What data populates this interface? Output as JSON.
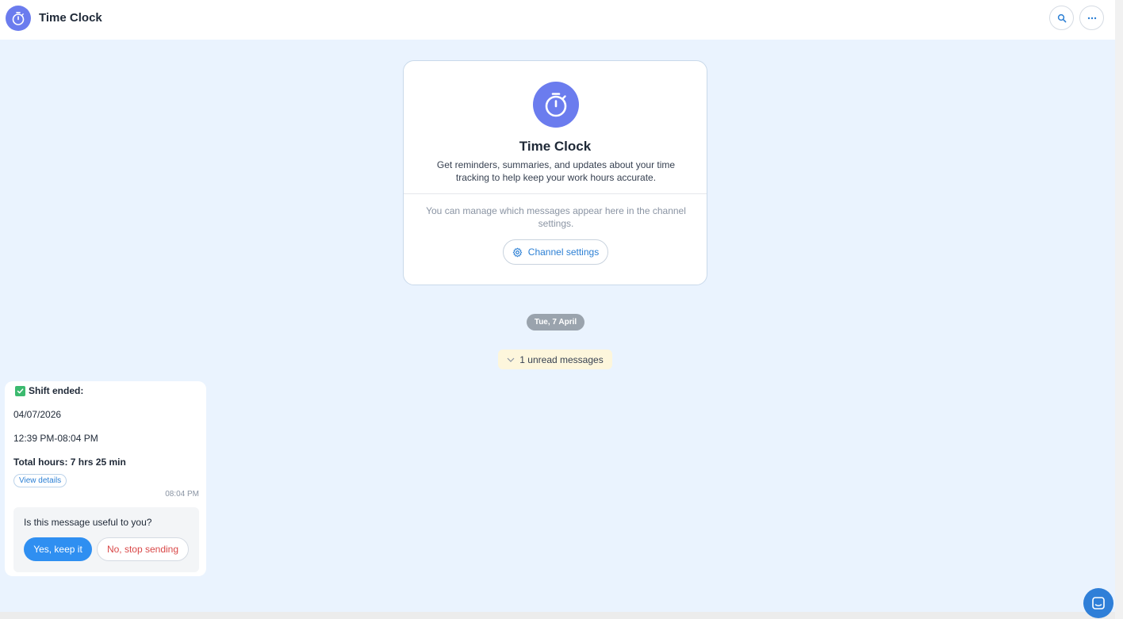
{
  "header": {
    "title": "Time Clock",
    "logo_icon": "stopwatch-icon",
    "search_icon": "search-icon",
    "more_icon": "more-horizontal-icon"
  },
  "intro": {
    "title": "Time Clock",
    "description": "Get reminders, summaries, and updates about your time tracking to help keep your work hours accurate.",
    "manage_text": "You can manage which messages appear here in the channel settings.",
    "settings_button": "Channel settings"
  },
  "feed": {
    "date_label": "Tue, 7 April",
    "unread_label": "1 unread messages"
  },
  "message": {
    "heading": "Shift ended:",
    "date": "04/07/2026",
    "time_range": "12:39 PM-08:04 PM",
    "total_hours": "Total hours: 7 hrs 25 min",
    "view_details": "View details",
    "timestamp": "08:04 PM",
    "feedback": {
      "question": "Is this message useful to you?",
      "yes_label": "Yes, keep it",
      "no_label": "No, stop sending"
    }
  },
  "colors": {
    "brand": "#6b7cee",
    "accent": "#2f8ff1",
    "danger": "#d94848",
    "background": "#eaf3fe"
  }
}
